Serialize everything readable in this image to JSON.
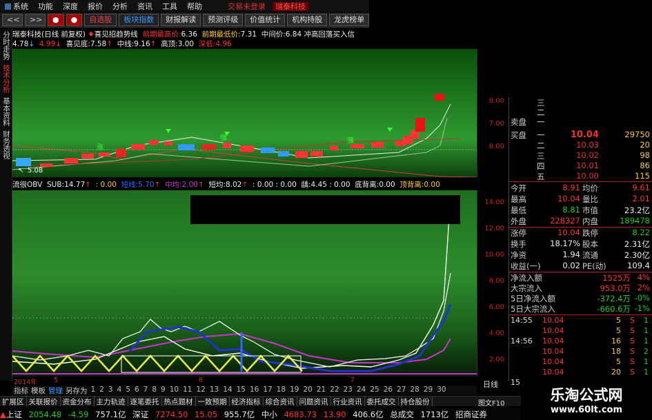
{
  "menubar": {
    "items": [
      "系统",
      "功能",
      "深度",
      "报价",
      "分析",
      "资讯",
      "工具",
      "帮助"
    ],
    "right_text": "交易未登录",
    "stock_tag": "瑞泰科技"
  },
  "toolbar": {
    "back": "<<",
    "forward": ">>",
    "btn_red1": "",
    "btn_red2": "",
    "buttons": [
      "自选股",
      "板块指数",
      "财报解读",
      "预测评级",
      "价值统计",
      "机构持股",
      "龙虎榜单"
    ]
  },
  "info1": {
    "title": "瑞泰科技(日线 前复权)",
    "signal": "喜见招趋势线",
    "high_label": "前期最高价:",
    "high_value": "6.36",
    "low_label": "前期最低价:",
    "low_value": "7.31",
    "mid_label": "中间价:",
    "mid_value": "6.84",
    "extra": "冲高回落买入信"
  },
  "info2": {
    "v1": "4.78",
    "v2": "4.99",
    "label3": "喜见底:",
    "v3": "7.58",
    "label4": "中线:",
    "v4": "9.16",
    "label5": "高顶:",
    "v5": "3.00",
    "label6": "深低:",
    "v6": "4.96"
  },
  "left_tabs": [
    "分时走势",
    "技术分析",
    "基本资料",
    "财务透视"
  ],
  "main_axis": [
    "8.00",
    "7.00",
    "6.00"
  ],
  "main_chart": {
    "low_marker": "5.08",
    "signal_label1": "涨",
    "signal_label2": "强",
    "signal_label3": "强"
  },
  "indicator_row": {
    "name": "流很OBV",
    "sub_label": "SUB:",
    "sub_value": "14.77",
    "v_a": ": 0.00",
    "jx_label": "短线:",
    "jx_value": "5.70",
    "mid_label": "中均:",
    "mid_value": "2.00",
    "short_label": "短均:",
    "short_value": "8.02",
    "v_b": ": 0.00",
    "v_c": ": 0.00",
    "zz_label": "龋:",
    "zz_value": "4.45",
    "v_d": ": 0.00",
    "div_label": "底背离:",
    "div_value": "0.00",
    "top_label": "顶背离:",
    "top_value": "0.00"
  },
  "ind_axis": [
    "14.00",
    "12.00",
    "10.00",
    "8.00",
    "6.00",
    "4.00",
    "2.00"
  ],
  "time_axis": [
    "2014年",
    "5",
    "6",
    "7"
  ],
  "bottom_tabs": {
    "items": [
      "指标",
      "模板",
      "管理",
      "另存为"
    ],
    "numbers": [
      "1",
      "2",
      "3",
      "4",
      "5",
      "6",
      "7",
      "8",
      "9",
      "10",
      "11",
      "12",
      "13",
      "14",
      "15",
      "16",
      "17",
      "18",
      "19",
      "20",
      "21",
      "22",
      "23",
      "24",
      "25",
      "26",
      "27",
      "28",
      "29",
      "30"
    ],
    "day_line": "日线"
  },
  "func_bar": [
    "扩展区",
    "关联报价",
    "资金分布",
    "主力轨迹",
    "逐笔委托",
    "热点题材",
    "一致预期",
    "经济指标",
    "综合资讯",
    "问题资讯",
    "行业资讯",
    "委托成交",
    "持仓股份"
  ],
  "figure_label": "图文F10",
  "status_bar": {
    "sh_label": "上证",
    "sh_index": "2054.48",
    "sh_change": "-4.59",
    "sh_amount": "757.1亿",
    "sz_label": "深证",
    "sz_index": "7274.50",
    "sz_change": "15.05",
    "sz_amount": "955.7亿",
    "zx_label": "中小",
    "zx_index": "4683.73",
    "zx_change": "13.90",
    "zx_amount": "406.6亿",
    "total_label": "总成交",
    "total_amount": "1713亿",
    "broker": "招商证券"
  },
  "orderbook": {
    "sell_label": "卖盘",
    "buy_label": "买盘",
    "sell_rows": [
      {
        "label": "三",
        "price": "",
        "vol": ""
      },
      {
        "label": "二",
        "price": "",
        "vol": ""
      },
      {
        "label": "一",
        "price": "",
        "vol": ""
      }
    ],
    "buy_rows": [
      {
        "label": "一",
        "price": "10.04",
        "vol": "29750"
      },
      {
        "label": "二",
        "price": "10.03",
        "vol": "20"
      },
      {
        "label": "三",
        "price": "10.02",
        "vol": "98"
      },
      {
        "label": "四",
        "price": "10.01",
        "vol": "86"
      },
      {
        "label": "五",
        "price": "10.00",
        "vol": "115"
      }
    ]
  },
  "quote": [
    {
      "l1": "今开",
      "v1": "8.91",
      "c1": "red",
      "l2": "均价",
      "v2": "9.61",
      "c2": "red"
    },
    {
      "l1": "最高",
      "v1": "10.04",
      "c1": "red",
      "l2": "量比",
      "v2": "2.01",
      "c2": "red"
    },
    {
      "l1": "最低",
      "v1": "8.81",
      "c1": "green",
      "l2": "市值",
      "v2": "23.2亿",
      "c2": "white"
    },
    {
      "l1": "外盘",
      "v1": "228327",
      "c1": "red",
      "l2": "内盘",
      "v2": "189478",
      "c2": "green"
    },
    {
      "l1": "涨停",
      "v1": "10.04",
      "c1": "red",
      "l2": "跌停",
      "v2": "8.22",
      "c2": "green"
    },
    {
      "l1": "换手",
      "v1": "18.17%",
      "c1": "white",
      "l2": "股本",
      "v2": "2.31亿",
      "c2": "white"
    },
    {
      "l1": "净资",
      "v1": "1.94",
      "c1": "white",
      "l2": "流通",
      "v2": "2.30亿",
      "c2": "white"
    },
    {
      "l1": "收益(一)",
      "v1": "0.02",
      "c1": "white",
      "l2": "PE(动)",
      "v2": "109.4",
      "c2": "white"
    }
  ],
  "flow": [
    {
      "label": "净流入额",
      "value": "1525万",
      "pct": "4%",
      "color": "red"
    },
    {
      "label": "大宗流入",
      "value": "953.0万",
      "pct": "2%",
      "color": "red"
    },
    {
      "label": "5日净流入额",
      "value": "-372.4万",
      "pct": "-0%",
      "color": "green"
    },
    {
      "label": "5日大宗流入",
      "value": "-660.6万",
      "pct": "-1%",
      "color": "green"
    }
  ],
  "ticks": [
    {
      "time": "14:55",
      "price": "10.04",
      "vol": "5",
      "side": "S",
      "n": "1"
    },
    {
      "time": "",
      "price": "10.04",
      "vol": "5",
      "side": "S",
      "n": "1"
    },
    {
      "time": "14:56",
      "price": "10.04",
      "vol": "16",
      "side": "S",
      "n": "1"
    },
    {
      "time": "",
      "price": "10.04",
      "vol": "18",
      "side": "S",
      "n": "2"
    },
    {
      "time": "",
      "price": "10.04",
      "vol": "5",
      "side": "S",
      "n": "1"
    },
    {
      "time": "",
      "price": "10.04",
      "vol": "20",
      "side": "S",
      "n": "1"
    },
    {
      "time": "15",
      "price": "",
      "vol": "",
      "side": "",
      "n": ""
    }
  ],
  "watermark": {
    "title": "乐淘公式网",
    "url": "www.60lt.com"
  }
}
